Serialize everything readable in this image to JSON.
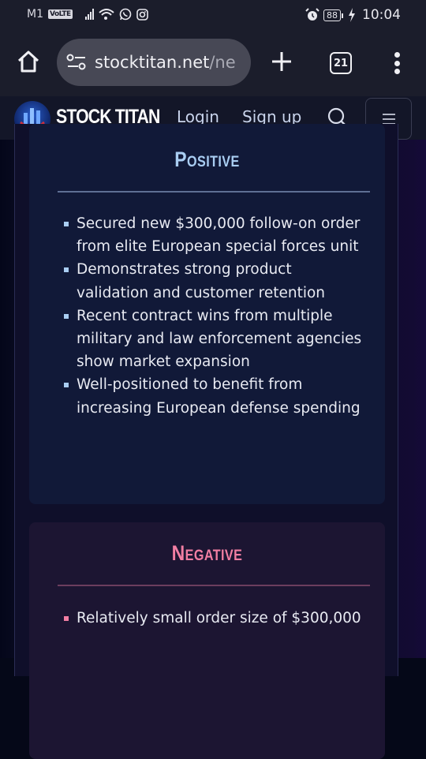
{
  "status_bar": {
    "carrier": "M1",
    "volte": "VoLTE",
    "battery": "88",
    "time": "10:04",
    "icons": [
      "signal-icon",
      "wifi-icon",
      "whatsapp-icon",
      "instagram-icon",
      "alarm-icon",
      "battery-icon",
      "charging-icon"
    ]
  },
  "browser": {
    "url_host": "stocktitan.net",
    "url_path": "/ne",
    "tab_count": "21"
  },
  "site_header": {
    "brand": "STOCK TITAN",
    "login": "Login",
    "signup": "Sign up"
  },
  "positive": {
    "title": "Positive",
    "items": [
      "Secured new $300,000 follow-on order from elite European special forces unit",
      "Demonstrates strong product validation and customer retention",
      "Recent contract wins from multiple military and law enforcement agencies show market expansion",
      "Well-positioned to benefit from increasing European defense spending"
    ]
  },
  "negative": {
    "title": "Negative",
    "items": [
      "Relatively small order size of $300,000"
    ]
  },
  "colors": {
    "positive_accent": "#a9cdf2",
    "negative_accent": "#f27ea3",
    "header_bg": "#131628",
    "browser_bg": "#1b1d2b"
  }
}
